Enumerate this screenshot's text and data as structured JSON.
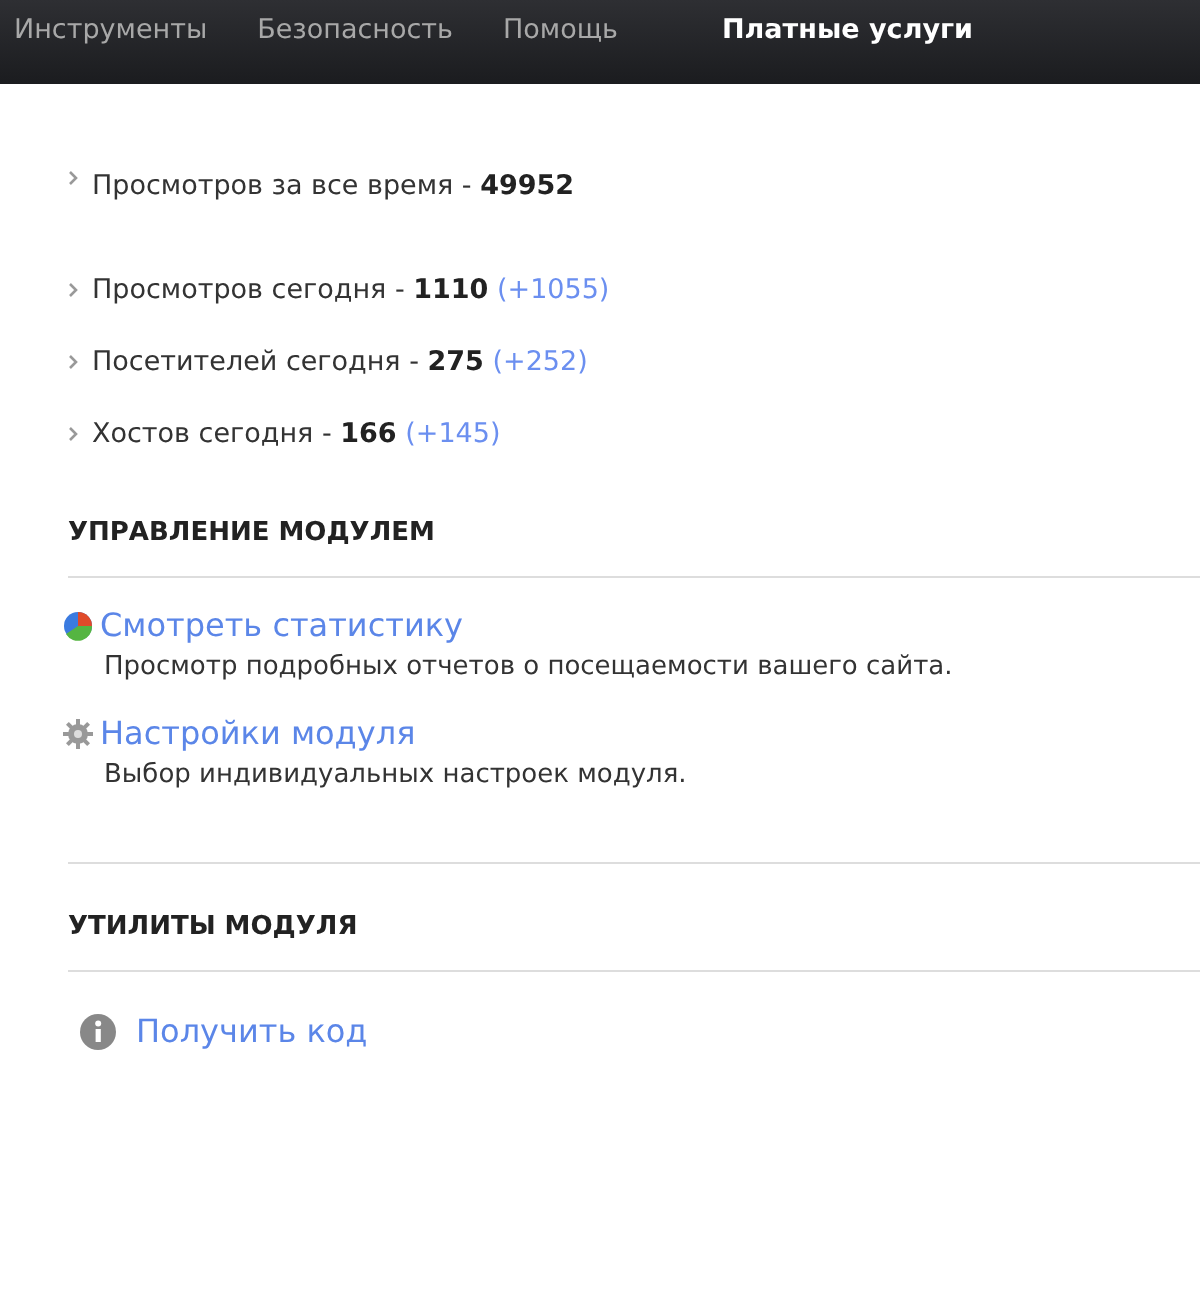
{
  "nav": [
    {
      "label": "Инструменты",
      "selected": false
    },
    {
      "label": "Безопасность",
      "selected": false
    },
    {
      "label": "Помощь",
      "selected": false
    },
    {
      "label": "Платные услуги",
      "selected": true
    }
  ],
  "stats": [
    {
      "label": "Просмотров за все время - ",
      "value": "49952"
    },
    {
      "label": "Просмотров сегодня - ",
      "value": "1110",
      "delta": "(+1055)"
    },
    {
      "label": "Посетителей сегодня - ",
      "value": "275",
      "delta": "(+252)"
    },
    {
      "label": "Хостов сегодня - ",
      "value": "166",
      "delta": "(+145)"
    }
  ],
  "sections": [
    {
      "title": "УПРАВЛЕНИЕ МОДУЛЕМ",
      "items": [
        {
          "kind": "chart",
          "link": "Смотреть статистику",
          "description": "Просмотр подробных отчетов о посещаемости вашего сайта."
        },
        {
          "kind": "settings",
          "link": "Настройки модуля",
          "description": "Выбор индивидуальных настроек модуля."
        }
      ]
    },
    {
      "title": "УТИЛИТЫ МОДУЛЯ",
      "items": [
        {
          "kind": "info",
          "link": "Получить код"
        }
      ]
    }
  ]
}
